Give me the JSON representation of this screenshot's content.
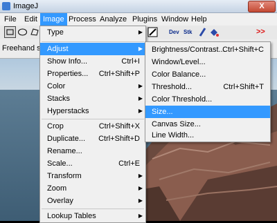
{
  "window": {
    "title": "ImageJ",
    "close_label": "X"
  },
  "menubar": [
    "File",
    "Edit",
    "Image",
    "Process",
    "Analyze",
    "Plugins",
    "Window",
    "Help"
  ],
  "active_menu": "Image",
  "toolbar": {
    "dev_label": "Dev",
    "stk_label": "Stk",
    "more_label": ">>"
  },
  "status_text": "Freehand sel",
  "image_menu": {
    "items": [
      {
        "label": "Type",
        "submenu": true
      },
      {
        "label": "Adjust",
        "submenu": true,
        "highlighted": true
      },
      {
        "label": "Show Info...",
        "shortcut": "Ctrl+I"
      },
      {
        "label": "Properties...",
        "shortcut": "Ctrl+Shift+P"
      },
      {
        "label": "Color",
        "submenu": true
      },
      {
        "label": "Stacks",
        "submenu": true
      },
      {
        "label": "Hyperstacks",
        "submenu": true
      },
      {
        "label": "Crop",
        "shortcut": "Ctrl+Shift+X"
      },
      {
        "label": "Duplicate...",
        "shortcut": "Ctrl+Shift+D"
      },
      {
        "label": "Rename..."
      },
      {
        "label": "Scale...",
        "shortcut": "Ctrl+E"
      },
      {
        "label": "Transform",
        "submenu": true
      },
      {
        "label": "Zoom",
        "submenu": true
      },
      {
        "label": "Overlay",
        "submenu": true
      },
      {
        "label": "Lookup Tables",
        "submenu": true
      }
    ]
  },
  "adjust_menu": {
    "items": [
      {
        "label": "Brightness/Contrast...",
        "shortcut": "Ctrl+Shift+C"
      },
      {
        "label": "Window/Level..."
      },
      {
        "label": "Color Balance..."
      },
      {
        "label": "Threshold...",
        "shortcut": "Ctrl+Shift+T"
      },
      {
        "label": "Color Threshold..."
      },
      {
        "label": "Size...",
        "highlighted": true
      },
      {
        "label": "Canvas Size..."
      },
      {
        "label": "Line Width..."
      }
    ]
  },
  "colors": {
    "highlight": "#3399ff",
    "menu_bg": "#f0f0f0"
  },
  "icons": {
    "submenu_arrow": "▶"
  }
}
